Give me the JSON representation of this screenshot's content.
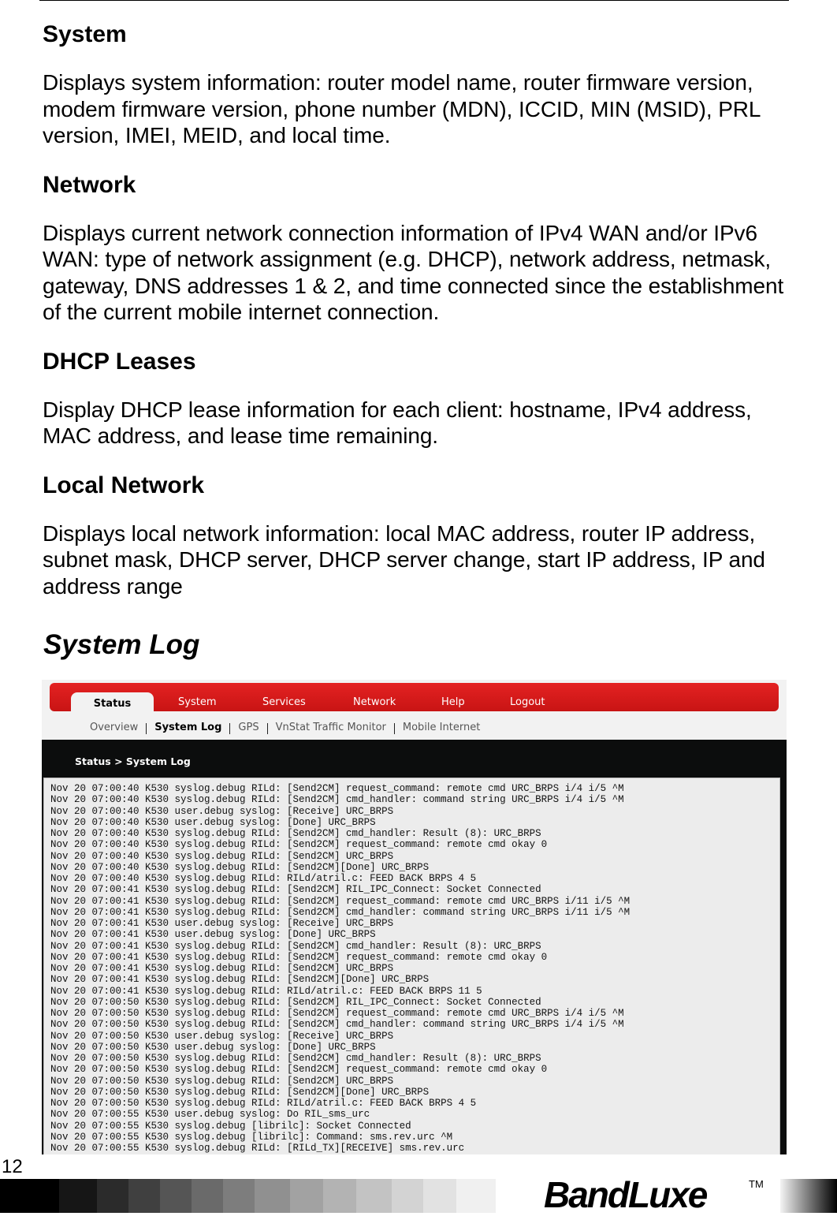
{
  "sections": [
    {
      "heading": "System",
      "body": "Displays system information: router model name, router firmware version, modem firmware version, phone number (MDN), ICCID, MIN (MSID), PRL version, IMEI, MEID, and local time."
    },
    {
      "heading": "Network",
      "body": "Displays current network connection information of IPv4 WAN and/or IPv6 WAN: type of network assignment (e.g. DHCP), network address, netmask, gateway, DNS addresses 1 & 2, and time connected since the establishment of the current mobile internet connection."
    },
    {
      "heading": "DHCP Leases",
      "body": "Display DHCP lease information for each client: hostname, IPv4 address, MAC address, and lease time remaining."
    },
    {
      "heading": "Local Network",
      "body": "Displays local network information: local MAC address, router IP address, subnet mask, DHCP server, DHCP server change, start IP address, IP and address range"
    }
  ],
  "system_log_title": "System Log",
  "screenshot": {
    "tabs": [
      "Status",
      "System",
      "Services",
      "Network",
      "Help",
      "Logout"
    ],
    "active_tab": "Status",
    "subnav": [
      "Overview",
      "System Log",
      "GPS",
      "VnStat Traffic Monitor",
      "Mobile Internet"
    ],
    "breadcrumb": "Status > System Log",
    "accent_color": "#d81b1b",
    "log_lines": [
      "Nov 20 07:00:40 K530 syslog.debug RILd: [Send2CM] request_command: remote cmd URC_BRPS i/4 i/5 ^M",
      "Nov 20 07:00:40 K530 syslog.debug RILd: [Send2CM] cmd_handler: command string URC_BRPS i/4 i/5 ^M",
      "Nov 20 07:00:40 K530 user.debug syslog: [Receive] URC_BRPS",
      "Nov 20 07:00:40 K530 user.debug syslog: [Done] URC_BRPS",
      "Nov 20 07:00:40 K530 syslog.debug RILd: [Send2CM] cmd_handler: Result (8): URC_BRPS",
      "Nov 20 07:00:40 K530 syslog.debug RILd: [Send2CM] request_command: remote cmd okay 0",
      "Nov 20 07:00:40 K530 syslog.debug RILd: [Send2CM] URC_BRPS",
      "Nov 20 07:00:40 K530 syslog.debug RILd: [Send2CM][Done] URC_BRPS",
      "Nov 20 07:00:40 K530 syslog.debug RILd: RILd/atril.c: FEED BACK BRPS 4 5",
      "Nov 20 07:00:41 K530 syslog.debug RILd: [Send2CM] RIL_IPC_Connect: Socket Connected",
      "Nov 20 07:00:41 K530 syslog.debug RILd: [Send2CM] request_command: remote cmd URC_BRPS i/11 i/5 ^M",
      "Nov 20 07:00:41 K530 syslog.debug RILd: [Send2CM] cmd_handler: command string URC_BRPS i/11 i/5 ^M",
      "Nov 20 07:00:41 K530 user.debug syslog: [Receive] URC_BRPS",
      "Nov 20 07:00:41 K530 user.debug syslog: [Done] URC_BRPS",
      "Nov 20 07:00:41 K530 syslog.debug RILd: [Send2CM] cmd_handler: Result (8): URC_BRPS",
      "Nov 20 07:00:41 K530 syslog.debug RILd: [Send2CM] request_command: remote cmd okay 0",
      "Nov 20 07:00:41 K530 syslog.debug RILd: [Send2CM] URC_BRPS",
      "Nov 20 07:00:41 K530 syslog.debug RILd: [Send2CM][Done] URC_BRPS",
      "Nov 20 07:00:41 K530 syslog.debug RILd: RILd/atril.c: FEED BACK BRPS 11 5",
      "Nov 20 07:00:50 K530 syslog.debug RILd: [Send2CM] RIL_IPC_Connect: Socket Connected",
      "Nov 20 07:00:50 K530 syslog.debug RILd: [Send2CM] request_command: remote cmd URC_BRPS i/4 i/5 ^M",
      "Nov 20 07:00:50 K530 syslog.debug RILd: [Send2CM] cmd_handler: command string URC_BRPS i/4 i/5 ^M",
      "Nov 20 07:00:50 K530 user.debug syslog: [Receive] URC_BRPS",
      "Nov 20 07:00:50 K530 user.debug syslog: [Done] URC_BRPS",
      "Nov 20 07:00:50 K530 syslog.debug RILd: [Send2CM] cmd_handler: Result (8): URC_BRPS",
      "Nov 20 07:00:50 K530 syslog.debug RILd: [Send2CM] request_command: remote cmd okay 0",
      "Nov 20 07:00:50 K530 syslog.debug RILd: [Send2CM] URC_BRPS",
      "Nov 20 07:00:50 K530 syslog.debug RILd: [Send2CM][Done] URC_BRPS",
      "Nov 20 07:00:50 K530 syslog.debug RILd: RILd/atril.c: FEED BACK BRPS 4 5",
      "Nov 20 07:00:55 K530 user.debug syslog: Do RIL_sms_urc",
      "Nov 20 07:00:55 K530 syslog.debug [librilc]: Socket Connected",
      "Nov 20 07:00:55 K530 syslog.debug [librilc]: Command: sms.rev.urc ^M",
      "Nov 20 07:00:55 K530 syslog.debug RILd: [RILd_TX][RECEIVE] sms.rev.urc"
    ]
  },
  "footer": {
    "page_number": "12",
    "brand": "BandLuxe",
    "trademark": "TM"
  }
}
